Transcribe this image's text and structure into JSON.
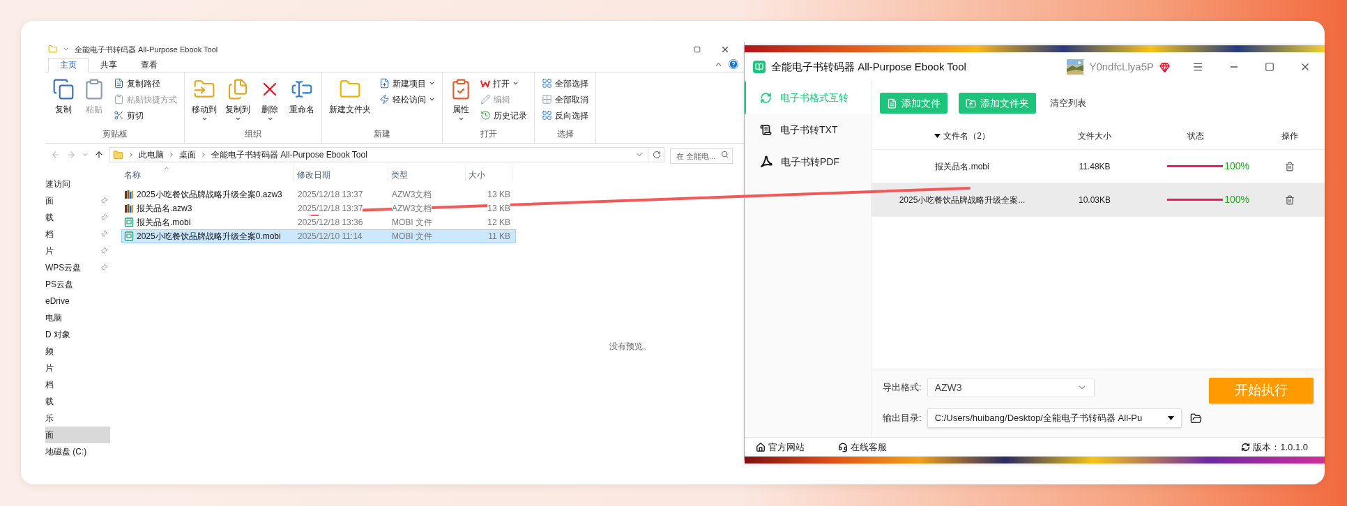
{
  "explorer": {
    "title": "全能电子书转码器 All-Purpose Ebook Tool",
    "ribbon_tabs": [
      {
        "label": "主页",
        "selected": true
      },
      {
        "label": "共享",
        "selected": false
      },
      {
        "label": "查看",
        "selected": false
      }
    ],
    "ribbon_groups": [
      {
        "label": "剪贴板",
        "items": [
          {
            "label": "复制",
            "kind": "large",
            "disabled": false,
            "menu": false
          },
          {
            "label": "粘贴",
            "kind": "large",
            "disabled": true,
            "menu": false
          },
          {
            "label": "复制路径",
            "kind": "small",
            "disabled": false,
            "menu": false
          },
          {
            "label": "粘贴快捷方式",
            "kind": "small",
            "disabled": true,
            "menu": false
          },
          {
            "label": "剪切",
            "kind": "small",
            "disabled": false,
            "menu": false
          }
        ]
      },
      {
        "label": "组织",
        "items": [
          {
            "label": "移动到",
            "kind": "large",
            "disabled": false,
            "menu": true
          },
          {
            "label": "复制到",
            "kind": "large",
            "disabled": false,
            "menu": true
          },
          {
            "label": "删除",
            "kind": "large",
            "disabled": false,
            "menu": true
          },
          {
            "label": "重命名",
            "kind": "large",
            "disabled": false,
            "menu": false
          }
        ]
      },
      {
        "label": "新建",
        "items": [
          {
            "label": "新建文件夹",
            "kind": "large",
            "disabled": false,
            "menu": false
          },
          {
            "label": "新建项目",
            "kind": "small",
            "disabled": false,
            "menu": true
          },
          {
            "label": "轻松访问",
            "kind": "small",
            "disabled": false,
            "menu": true
          }
        ]
      },
      {
        "label": "打开",
        "items": [
          {
            "label": "属性",
            "kind": "large",
            "disabled": false,
            "menu": true
          },
          {
            "label": "打开",
            "kind": "small",
            "disabled": false,
            "menu": true
          },
          {
            "label": "编辑",
            "kind": "small",
            "disabled": true,
            "menu": false
          },
          {
            "label": "历史记录",
            "kind": "small",
            "disabled": false,
            "menu": false
          }
        ]
      },
      {
        "label": "选择",
        "items": [
          {
            "label": "全部选择",
            "kind": "small",
            "disabled": false,
            "menu": false
          },
          {
            "label": "全部取消",
            "kind": "small",
            "disabled": false,
            "menu": false
          },
          {
            "label": "反向选择",
            "kind": "small",
            "disabled": false,
            "menu": false
          }
        ]
      }
    ],
    "breadcrumb": [
      "此电脑",
      "桌面",
      "全能电子书转码器 All-Purpose Ebook Tool"
    ],
    "search": {
      "placeholder": "在 全能电..."
    },
    "nav_items": [
      {
        "label": "速访问",
        "pinned": false,
        "selected": false
      },
      {
        "label": "面",
        "pinned": true,
        "selected": false
      },
      {
        "label": "载",
        "pinned": true,
        "selected": false
      },
      {
        "label": "档",
        "pinned": true,
        "selected": false
      },
      {
        "label": "片",
        "pinned": true,
        "selected": false
      },
      {
        "label": "WPS云盘",
        "pinned": true,
        "selected": false
      },
      {
        "label": "PS云盘",
        "pinned": false,
        "selected": false
      },
      {
        "label": "eDrive",
        "pinned": false,
        "selected": false
      },
      {
        "label": "电脑",
        "pinned": false,
        "selected": false
      },
      {
        "label": "D 对象",
        "pinned": false,
        "selected": false
      },
      {
        "label": "频",
        "pinned": false,
        "selected": false
      },
      {
        "label": "片",
        "pinned": false,
        "selected": false
      },
      {
        "label": "档",
        "pinned": false,
        "selected": false
      },
      {
        "label": "载",
        "pinned": false,
        "selected": false
      },
      {
        "label": "乐",
        "pinned": false,
        "selected": false
      },
      {
        "label": "面",
        "pinned": false,
        "selected": true
      },
      {
        "label": "地磁盘 (C:)",
        "pinned": false,
        "selected": false
      }
    ],
    "columns": [
      "名称",
      "修改日期",
      "类型",
      "大小"
    ],
    "files": [
      {
        "name": "2025小吃餐饮品牌战略升级全案0.azw3",
        "date": "2025/12/18 13:37",
        "type": "AZW3文档",
        "size": "13 KB",
        "kind": "azw3",
        "selected": false
      },
      {
        "name": "报关品名.azw3",
        "date": "2025/12/18 13:37",
        "type": "AZW3文档",
        "size": "13 KB",
        "kind": "azw3",
        "selected": false
      },
      {
        "name": "报关品名.mobi",
        "date": "2025/12/18 13:36",
        "type": "MOBI 文件",
        "size": "12 KB",
        "kind": "mobi",
        "selected": false
      },
      {
        "name": "2025小吃餐饮品牌战略升级全案0.mobi",
        "date": "2025/12/10 11:14",
        "type": "MOBI 文件",
        "size": "11 KB",
        "kind": "mobi",
        "selected": true
      }
    ],
    "preview_text": "没有预览。"
  },
  "app": {
    "title": "全能电子书转码器 All-Purpose Ebook Tool",
    "user_name": "Y0ndfcLlya5P",
    "sidebar": [
      {
        "label": "电子书格式互转",
        "selected": true
      },
      {
        "label": "电子书转TXT",
        "selected": false
      },
      {
        "label": "电子书转PDF",
        "selected": false
      }
    ],
    "toolbar": [
      {
        "label": "添加文件",
        "kind": "primary"
      },
      {
        "label": "添加文件夹",
        "kind": "primary"
      },
      {
        "label": "清空列表",
        "kind": "text"
      }
    ],
    "columns": [
      "文件名（2）",
      "文件大小",
      "状态",
      "操作"
    ],
    "rows": [
      {
        "name": "报关品名.mobi",
        "size": "11.48KB",
        "level": 1,
        "reading": "100%",
        "selected": false
      },
      {
        "name": "2025小吃餐饮品牌战略升级全案...",
        "size": "10.03KB",
        "level": 1,
        "reading": "100%",
        "selected": true
      }
    ],
    "export_format": {
      "label": "导出格式:",
      "value": "AZW3"
    },
    "output_dir": {
      "label": "输出目录:",
      "value": "C:/Users/huibang/Desktop/全能电子书转码器 All-Pu"
    },
    "start_button": "开始执行",
    "footer_links": [
      "官方网站",
      "在线客服"
    ],
    "version": "版本：1.0.1.0"
  }
}
